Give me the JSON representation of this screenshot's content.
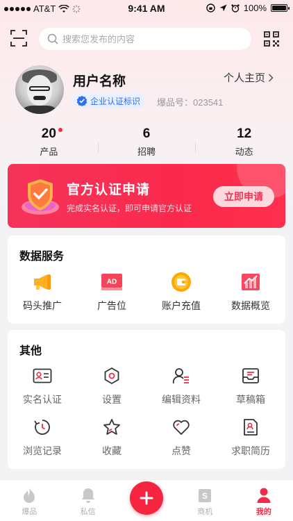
{
  "status_bar": {
    "carrier": "AT&T",
    "time": "9:41 AM",
    "battery": "100%"
  },
  "search": {
    "placeholder": "搜索您发布的内容"
  },
  "profile": {
    "username": "用户名称",
    "homepage_label": "个人主页",
    "cert_label": "企业认证标识",
    "user_id": "爆品号：023541"
  },
  "stats": [
    {
      "value": "20",
      "label": "产品",
      "has_dot": true
    },
    {
      "value": "6",
      "label": "招聘",
      "has_dot": false
    },
    {
      "value": "12",
      "label": "动态",
      "has_dot": false
    }
  ],
  "banner": {
    "title": "官方认证申请",
    "subtitle": "完成实名认证，即可申请官方认证",
    "button": "立即申请"
  },
  "data_services": {
    "title": "数据服务",
    "items": [
      {
        "label": "码头推广",
        "icon": "megaphone-icon"
      },
      {
        "label": "广告位",
        "icon": "ad-icon"
      },
      {
        "label": "账户充值",
        "icon": "wallet-icon"
      },
      {
        "label": "数据概览",
        "icon": "chart-icon"
      }
    ]
  },
  "other": {
    "title": "其他",
    "items": [
      {
        "label": "实名认证",
        "icon": "id-card-icon"
      },
      {
        "label": "设置",
        "icon": "settings-icon"
      },
      {
        "label": "编辑资料",
        "icon": "edit-profile-icon"
      },
      {
        "label": "草稿箱",
        "icon": "drafts-icon"
      },
      {
        "label": "浏览记录",
        "icon": "history-icon"
      },
      {
        "label": "收藏",
        "icon": "star-icon"
      },
      {
        "label": "点赞",
        "icon": "heart-icon"
      },
      {
        "label": "求职简历",
        "icon": "resume-icon"
      }
    ]
  },
  "tab_bar": {
    "items": [
      {
        "label": "爆品",
        "icon": "flame-icon",
        "active": false
      },
      {
        "label": "私信",
        "icon": "bell-icon",
        "active": false
      },
      {
        "label": "商机",
        "icon": "shop-icon",
        "active": false
      },
      {
        "label": "我的",
        "icon": "user-icon",
        "active": true
      }
    ],
    "accent_color": "#f02a48"
  }
}
